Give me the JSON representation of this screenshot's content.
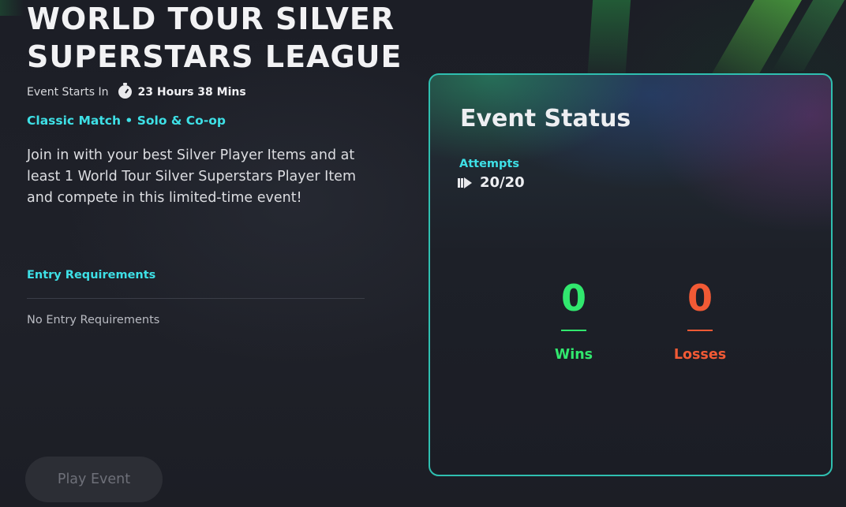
{
  "event": {
    "title_line1": "WORLD TOUR SILVER",
    "title_line2": "SUPERSTARS LEAGUE",
    "starts_label": "Event Starts In",
    "starts_icon": "stopwatch-icon",
    "starts_time": "23 Hours 38 Mins",
    "mode": "Classic Match • Solo & Co-op",
    "description": "Join in with your best Silver Player Items and at least 1 World Tour Silver Superstars Player Item and compete in this limited-time event!"
  },
  "requirements": {
    "heading": "Entry Requirements",
    "value": "No Entry Requirements"
  },
  "actions": {
    "play_label": "Play Event",
    "play_enabled": false
  },
  "status": {
    "title": "Event Status",
    "attempts_label": "Attempts",
    "attempts_icon": "attempts-icon",
    "attempts_value": "20/20",
    "wins_value": "0",
    "wins_label": "Wins",
    "losses_value": "0",
    "losses_label": "Losses"
  },
  "colors": {
    "accent_cyan": "#3ee0e6",
    "wins_green": "#31e86e",
    "losses_orange": "#f25a35",
    "panel_border": "#2fbfb0",
    "background": "#1d1f27"
  }
}
